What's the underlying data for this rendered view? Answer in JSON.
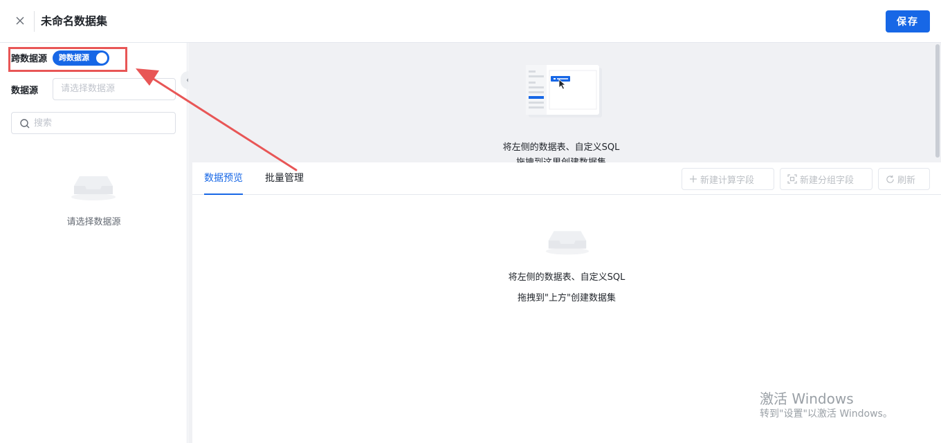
{
  "header": {
    "title": "未命名数据集",
    "save_label": "保存"
  },
  "left": {
    "cross_source_label": "跨数据源",
    "cross_source_switch_text": "跨数据源",
    "cross_source_enabled": true,
    "datasource_label": "数据源",
    "datasource_placeholder": "请选择数据源",
    "search_placeholder": "搜索",
    "empty_text": "请选择数据源"
  },
  "canvas": {
    "hint_line1": "将左侧的数据表、自定义SQL",
    "hint_line2": "拖拽到这里创建数据集"
  },
  "tabs": [
    {
      "label": "数据预览",
      "active": true
    },
    {
      "label": "批量管理",
      "active": false
    }
  ],
  "toolbar": {
    "new_calc_field": "新建计算字段",
    "new_group_field": "新建分组字段",
    "refresh": "刷新"
  },
  "preview": {
    "hint_line1": "将左侧的数据表、自定义SQL",
    "hint_line2": "拖拽到\"上方\"创建数据集"
  },
  "watermark": {
    "title": "激活 Windows",
    "subtitle": "转到\"设置\"以激活 Windows。"
  },
  "colors": {
    "primary": "#1767e6",
    "annotation_red": "#e85656"
  }
}
